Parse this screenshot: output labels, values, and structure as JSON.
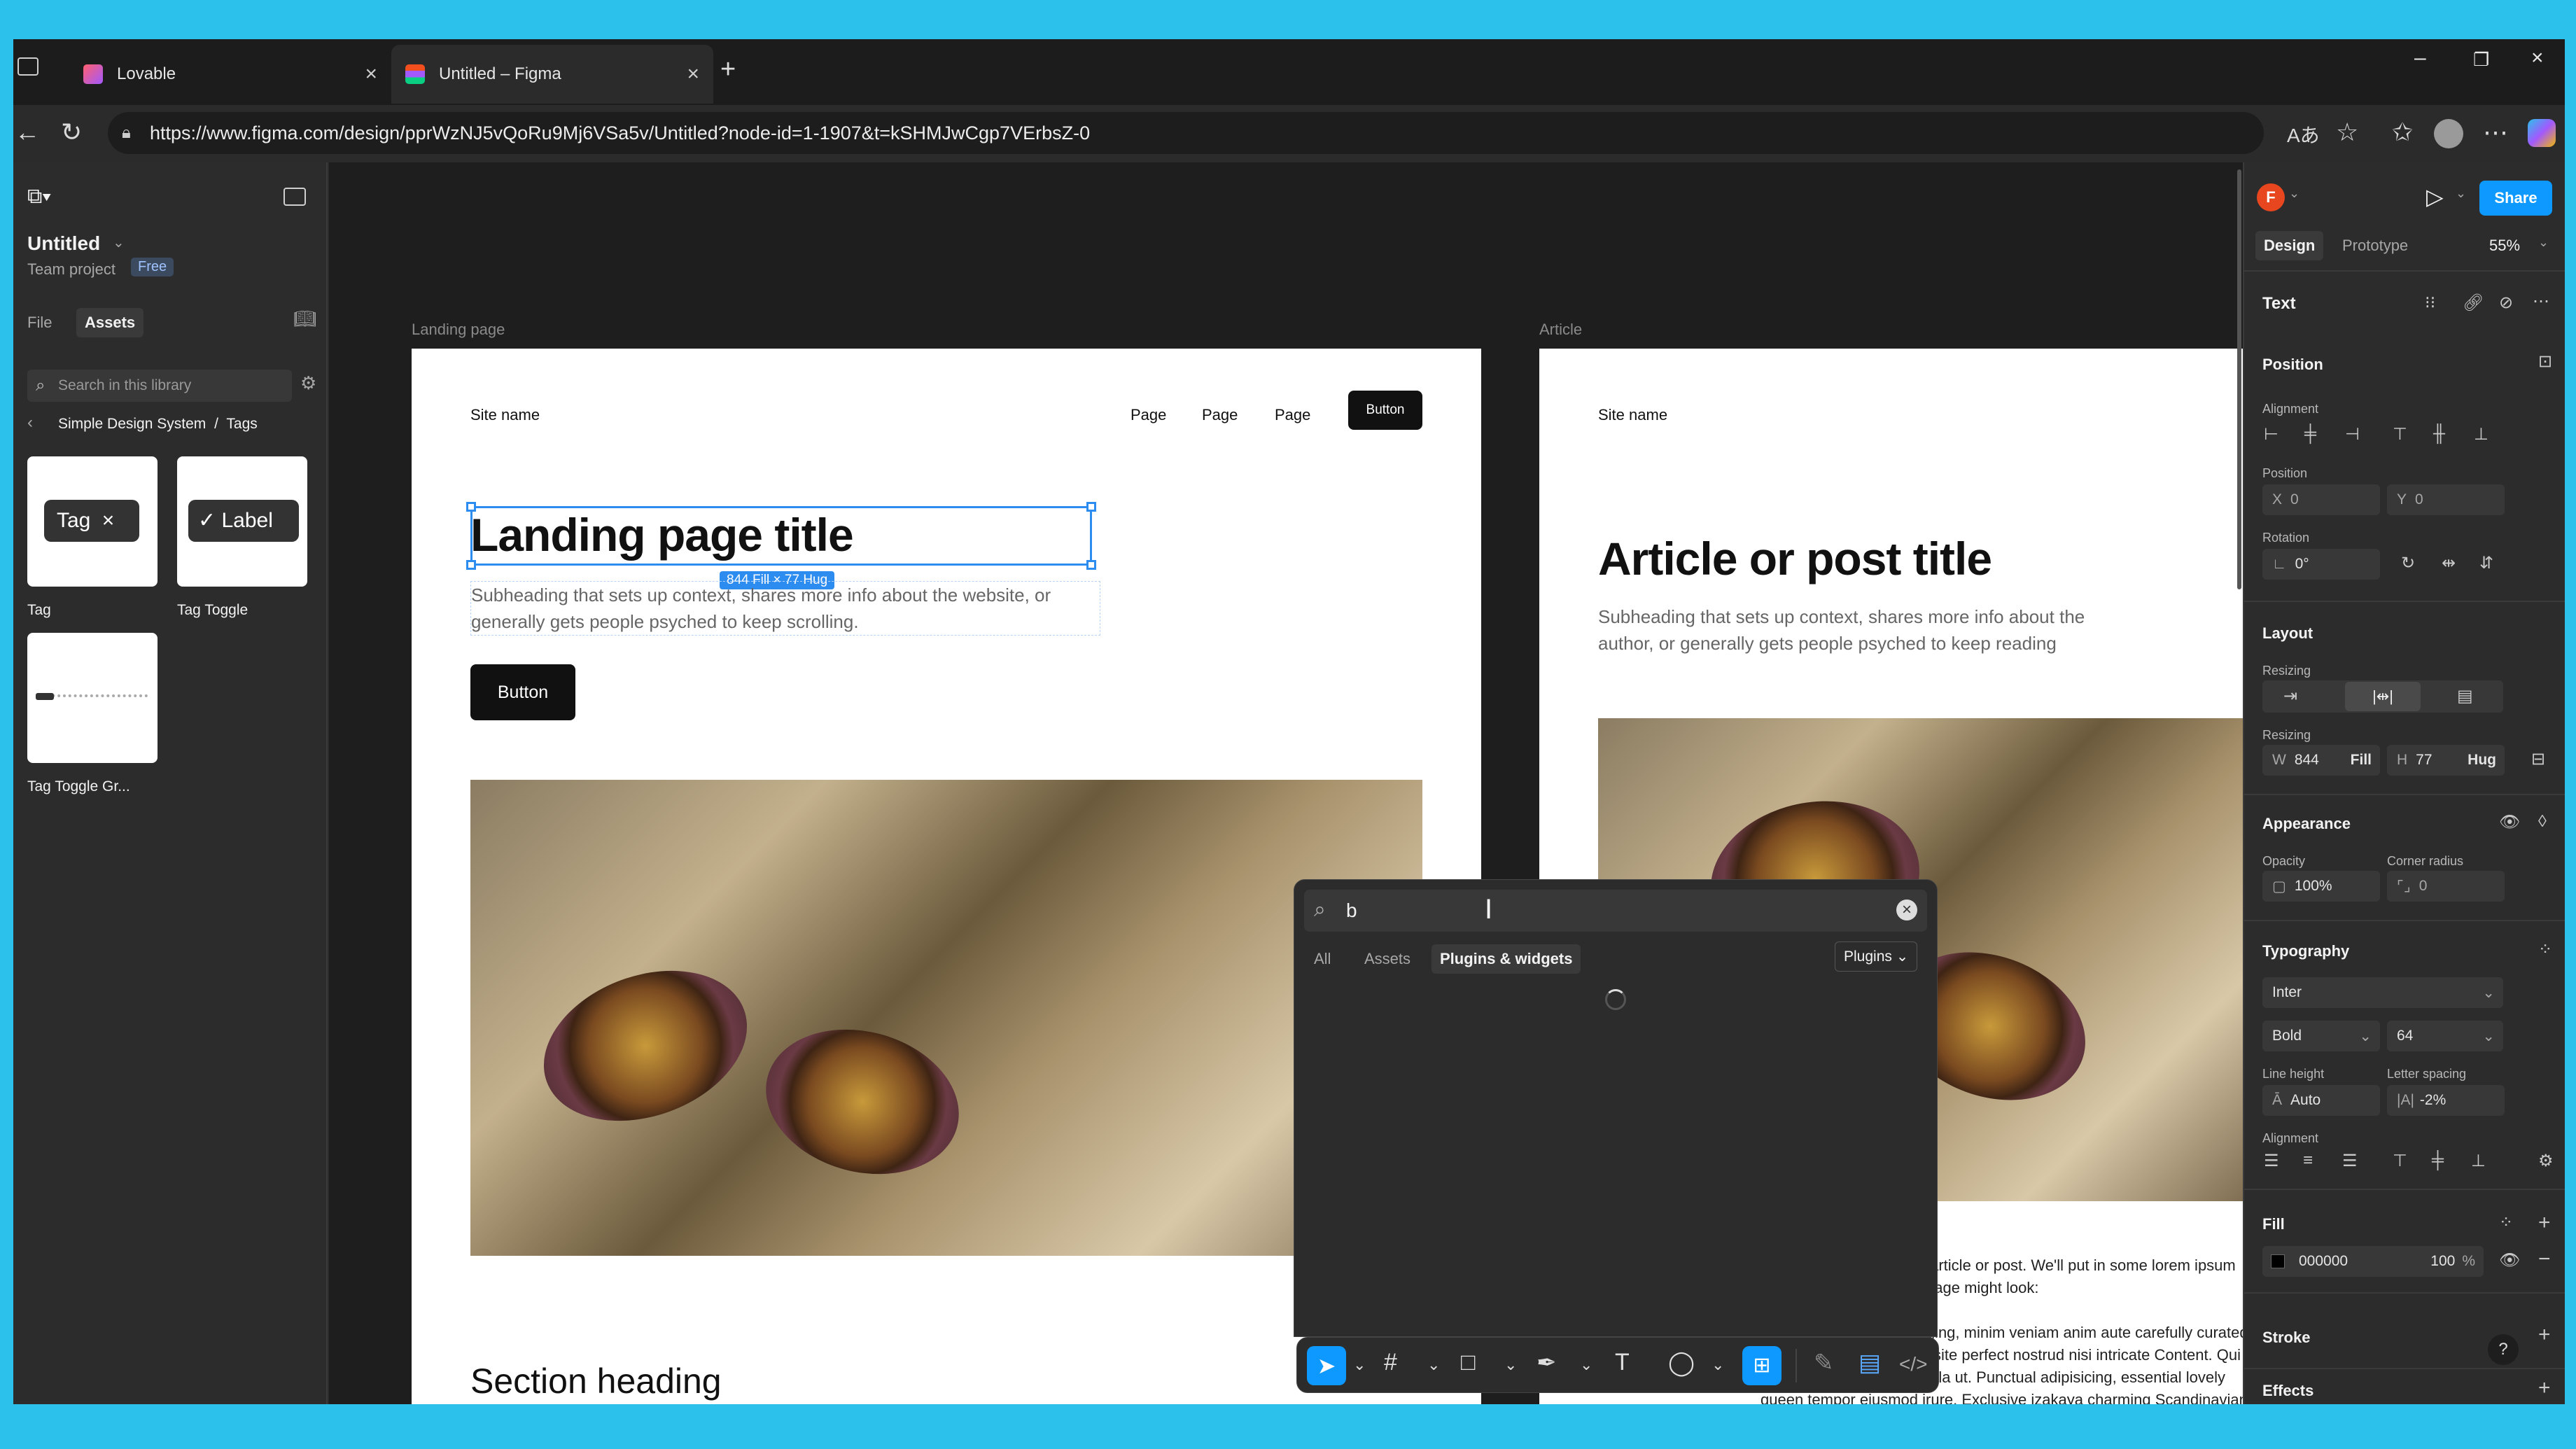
{
  "browser": {
    "tabs": [
      {
        "title": "Lovable",
        "color": "#e94e77"
      },
      {
        "title": "Untitled – Figma",
        "color": "#a259ff"
      }
    ],
    "url": "https://www.figma.com/design/pprWzNJ5vQoRu9Mj6VSa5v/Untitled?node-id=1-1907&t=kSHMJwCgp7VErbsZ-0"
  },
  "left_panel": {
    "file_name": "Untitled",
    "project": "Team project",
    "plan_badge": "Free",
    "tabs": [
      "File",
      "Assets"
    ],
    "search_placeholder": "Search in this library",
    "breadcrumb": [
      "Simple Design System",
      "/",
      "Tags"
    ],
    "assets": [
      {
        "name": "Tag",
        "preview": "Tag"
      },
      {
        "name": "Tag Toggle",
        "preview": "Label"
      },
      {
        "name": "Tag Toggle Gr..."
      }
    ]
  },
  "canvas": {
    "frame1": {
      "label": "Landing page",
      "site": "Site name",
      "nav": [
        "Page",
        "Page",
        "Page"
      ],
      "nav_button": "Button",
      "title": "Landing page title",
      "size_badge": "844 Fill × 77 Hug",
      "subtitle": "Subheading that sets up context, shares more info about the website, or generally gets people psyched to keep scrolling.",
      "button": "Button",
      "section": "Section heading"
    },
    "frame2": {
      "label": "Article",
      "site": "Site name",
      "title": "Article or post title",
      "subtitle": "Subheading that sets up context, shares more info about the author, or generally gets people psyched to keep reading",
      "body1": "Body text for your whole article or post. We'll put in some lorem ipsum to show how a filled-out page might look:",
      "body2": "Excepteur efficient emerging, minim veniam anim aute carefully curated Ginza conversation exquisite perfect nostrud nisi intricate Content. Qui international first-class nulla ut. Punctual adipisicing, essential lovely queen tempor eiusmod irure. Exclusive izakaya charming Scandinavian impeccable aute quality of life soft power pariatur Melbourne occaecat discerning. Qui wardrobe aliquip, et Porter destination"
    }
  },
  "search_popup": {
    "query": "b",
    "tabs": [
      "All",
      "Assets",
      "Plugins & widgets"
    ],
    "active_tab": "Plugins & widgets",
    "filter": "Plugins"
  },
  "right_panel": {
    "avatar": "F",
    "share": "Share",
    "tabs": [
      "Design",
      "Prototype"
    ],
    "zoom": "55%",
    "layer_type": "Text",
    "position": {
      "title": "Position",
      "alignment_label": "Alignment",
      "position_label": "Position",
      "x": "0",
      "y": "0",
      "rotation_label": "Rotation",
      "rotation": "0°"
    },
    "layout": {
      "title": "Layout",
      "resizing_label": "Resizing",
      "w": "844",
      "w_mode": "Fill",
      "h": "77",
      "h_mode": "Hug"
    },
    "appearance": {
      "title": "Appearance",
      "opacity_label": "Opacity",
      "opacity": "100%",
      "radius_label": "Corner radius",
      "radius": "0"
    },
    "typography": {
      "title": "Typography",
      "font": "Inter",
      "weight": "Bold",
      "size": "64",
      "lh_label": "Line height",
      "line_height": "Auto",
      "ls_label": "Letter spacing",
      "letter_spacing": "-2%",
      "alignment_label": "Alignment"
    },
    "fill": {
      "title": "Fill",
      "hex": "000000",
      "opacity": "100",
      "unit": "%",
      "swatch": "#000000"
    },
    "stroke": "Stroke",
    "effects": "Effects"
  }
}
